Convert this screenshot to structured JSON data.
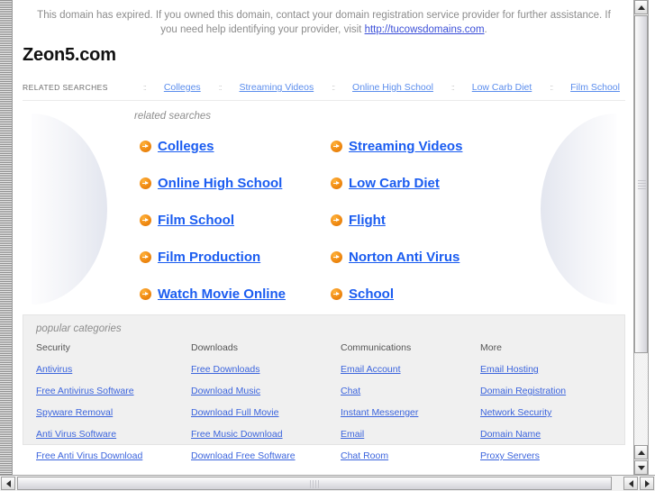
{
  "banner": {
    "text_before": "This domain has expired. If you owned this domain, contact your domain registration service provider for further assistance. If you need help identifying your provider, visit ",
    "link_text": "http://tucowsdomains.com",
    "text_after": "."
  },
  "domain": {
    "name": "Zeon5.com"
  },
  "related_bar": {
    "label": "RELATED SEARCHES",
    "separator": "::",
    "items": [
      {
        "label": "Colleges"
      },
      {
        "label": "Streaming Videos"
      },
      {
        "label": "Online High School"
      },
      {
        "label": "Low Carb Diet"
      },
      {
        "label": "Film School"
      }
    ]
  },
  "related_main": {
    "caption": "related searches",
    "arrow_icon": "arrow-circle-right-icon",
    "items": [
      {
        "label": "Colleges"
      },
      {
        "label": "Streaming Videos"
      },
      {
        "label": "Online High School"
      },
      {
        "label": "Low Carb Diet"
      },
      {
        "label": "Film School"
      },
      {
        "label": "Flight"
      },
      {
        "label": "Film Production"
      },
      {
        "label": "Norton Anti Virus"
      },
      {
        "label": "Watch Movie Online"
      },
      {
        "label": "School"
      }
    ]
  },
  "popular_categories": {
    "caption": "popular categories",
    "columns": [
      {
        "heading": "Security",
        "links": [
          "Antivirus",
          "Free Antivirus Software",
          "Spyware Removal",
          "Anti Virus Software",
          "Free Anti Virus Download"
        ]
      },
      {
        "heading": "Downloads",
        "links": [
          "Free Downloads",
          "Download Music",
          "Download Full Movie",
          "Free Music Download",
          "Download Free Software"
        ]
      },
      {
        "heading": "Communications",
        "links": [
          "Email Account",
          "Chat",
          "Instant Messenger",
          "Email",
          "Chat Room"
        ]
      },
      {
        "heading": "More",
        "links": [
          "Email Hosting",
          "Domain Registration",
          "Network Security",
          "Domain Name",
          "Proxy Servers"
        ]
      }
    ]
  },
  "colors": {
    "link_blue": "#1a5cf0",
    "bar_link_blue": "#5b8ded",
    "category_link_blue": "#3b64dd",
    "arrow_orange": "#f08a12",
    "banner_gray": "#8c8c8c",
    "panel_gray": "#f0f0f0"
  }
}
